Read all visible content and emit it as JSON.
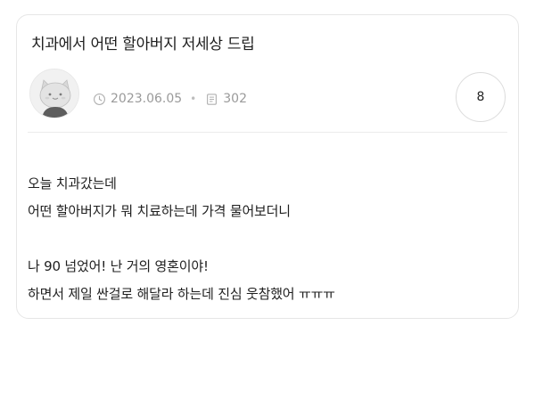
{
  "post": {
    "title": "치과에서 어떤 할아버지 저세상 드립",
    "avatar_icon": "cat-avatar-icon",
    "date": "2023.06.05",
    "views": "302",
    "comment_count": "8",
    "icons": {
      "date": "clock-icon",
      "views": "document-icon"
    },
    "body": {
      "line1": "오늘 치과갔는데",
      "line2": "어떤 할아버지가 뭐 치료하는데 가격 물어보더니",
      "line3": "나 90 넘었어! 난 거의 영혼이야!",
      "line4": "하면서 제일 싼걸로 해달라 하는데 진심 웃참했어 ㅠㅠㅠ"
    }
  },
  "colors": {
    "card_border": "#e6e6e6",
    "meta_text": "#9a9a9a",
    "body_text": "#1f1f1f"
  }
}
